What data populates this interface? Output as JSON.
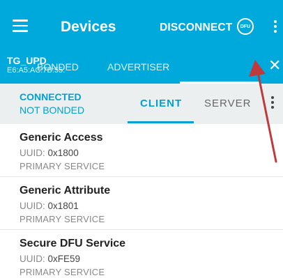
{
  "toolbar": {
    "title": "Devices",
    "disconnect_label": "DISCONNECT",
    "dfu_label": "DFU",
    "menu_icon": "hamburger-menu-icon",
    "overflow_icon": "more-vert-icon"
  },
  "tabs": {
    "bonded": "BONDED",
    "advertiser": "ADVERTISER",
    "device_name": "TG_UPD",
    "device_address": "E6:A5:AC:7B:55:",
    "close_icon": "close-icon"
  },
  "status": {
    "connection": "CONNECTED",
    "bond": "NOT BONDED",
    "client_tab": "CLIENT",
    "server_tab": "SERVER"
  },
  "services": [
    {
      "name": "Generic Access",
      "uuid_label": "UUID: ",
      "uuid": "0x1800",
      "type": "PRIMARY SERVICE"
    },
    {
      "name": "Generic Attribute",
      "uuid_label": "UUID: ",
      "uuid": "0x1801",
      "type": "PRIMARY SERVICE"
    },
    {
      "name": "Secure DFU Service",
      "uuid_label": "UUID: ",
      "uuid": "0xFE59",
      "type": "PRIMARY SERVICE"
    }
  ],
  "colors": {
    "primary": "#00a9dc",
    "accent": "#00a0d2",
    "annotation": "#c0393b"
  }
}
